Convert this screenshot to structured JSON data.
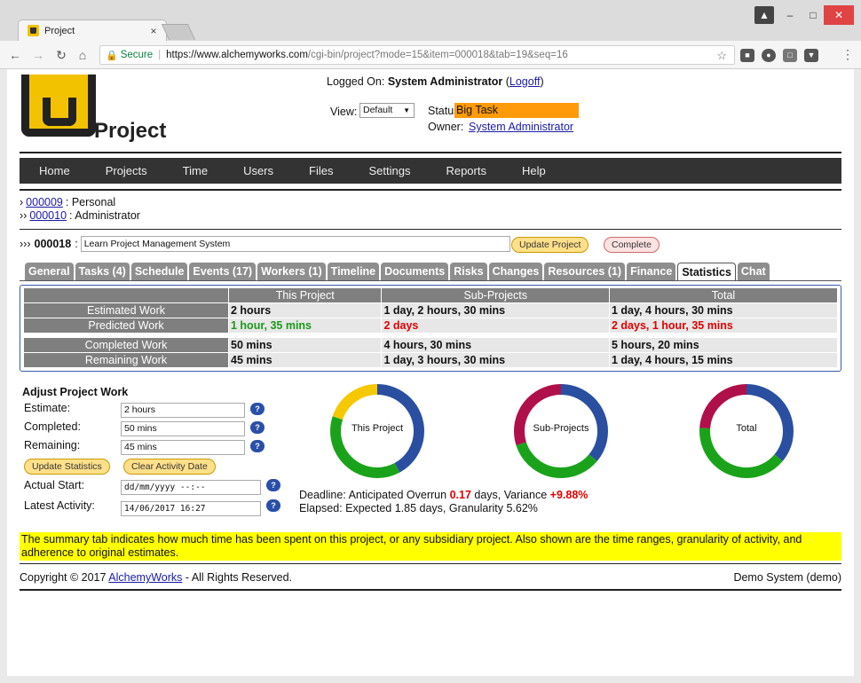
{
  "browser": {
    "tab_title": "Project",
    "tab_close": "×",
    "secure_label": "Secure",
    "url_host": "https://www.alchemyworks.com",
    "url_path": "/cgi-bin/project?mode=15&item=000018&tab=19&seq=16"
  },
  "header": {
    "app_title": "Project",
    "logged_on_label": "Logged On:",
    "user_name": "System Administrator",
    "logoff_label": "Logoff",
    "view_label": "View:",
    "view_selected": "Default",
    "status_label": "Status:",
    "status_value": "Big Task",
    "status_color": "#ff9a0a",
    "owner_label": "Owner:",
    "owner_value": "System Administrator"
  },
  "nav": {
    "items": [
      "Home",
      "Projects",
      "Time",
      "Users",
      "Files",
      "Settings",
      "Reports",
      "Help"
    ]
  },
  "breadcrumbs": [
    {
      "prefix": "›",
      "id": "000009",
      "name": ": Personal"
    },
    {
      "prefix": "››",
      "id": "000010",
      "name": ": Administrator"
    }
  ],
  "project": {
    "prefix": "›››",
    "id": "000018",
    "colon": ":",
    "name": "Learn Project Management System",
    "update_label": "Update Project",
    "complete_label": "Complete"
  },
  "tabs": [
    "General",
    "Tasks (4)",
    "Schedule",
    "Events (17)",
    "Workers (1)",
    "Timeline",
    "Documents",
    "Risks",
    "Changes",
    "Resources (1)",
    "Finance",
    "Statistics",
    "Chat"
  ],
  "active_tab": "Statistics",
  "stats": {
    "columns": [
      "This Project",
      "Sub-Projects",
      "Total"
    ],
    "rows": [
      {
        "label": "Estimated Work",
        "values": [
          "2 hours",
          "1 day, 2 hours, 30 mins",
          "1 day, 4 hours, 30 mins"
        ]
      },
      {
        "label": "Predicted Work",
        "values": [
          "1 hour, 35 mins",
          "2 days",
          "2 days, 1 hour, 35 mins"
        ]
      },
      {
        "label": "Completed Work",
        "values": [
          "50 mins",
          "4 hours, 30 mins",
          "5 hours, 20 mins"
        ]
      },
      {
        "label": "Remaining Work",
        "values": [
          "45 mins",
          "1 day, 3 hours, 30 mins",
          "1 day, 4 hours, 15 mins"
        ]
      }
    ]
  },
  "adjust": {
    "title": "Adjust Project Work",
    "estimate_label": "Estimate:",
    "estimate_value": "2 hours",
    "completed_label": "Completed:",
    "completed_value": "50 mins",
    "remaining_label": "Remaining:",
    "remaining_value": "45 mins",
    "update_stats_label": "Update Statistics",
    "clear_activity_label": "Clear Activity Date",
    "actual_start_label": "Actual Start:",
    "actual_start_value": "dd/mm/yyyy --:--",
    "latest_activity_label": "Latest Activity:",
    "latest_activity_value": "14/06/2017 16:27",
    "help_glyph": "?"
  },
  "donuts": [
    {
      "label": "This Project",
      "segments": [
        {
          "color": "#2a4fa0",
          "fraction": 0.42
        },
        {
          "color": "#1aa31a",
          "fraction": 0.38
        },
        {
          "color": "#f5c800",
          "fraction": 0.2
        }
      ]
    },
    {
      "label": "Sub-Projects",
      "segments": [
        {
          "color": "#2a4fa0",
          "fraction": 0.36
        },
        {
          "color": "#1aa31a",
          "fraction": 0.34
        },
        {
          "color": "#b0104a",
          "fraction": 0.3
        }
      ]
    },
    {
      "label": "Total",
      "segments": [
        {
          "color": "#2a4fa0",
          "fraction": 0.36
        },
        {
          "color": "#1aa31a",
          "fraction": 0.4
        },
        {
          "color": "#b0104a",
          "fraction": 0.24
        }
      ]
    }
  ],
  "deadline": {
    "line1_prefix": "Deadline: Anticipated Overrun",
    "overrun_value": "0.17",
    "line1_mid": "days, Variance",
    "variance_value": "+9.88%",
    "line2": "Elapsed: Expected 1.85 days, Granularity 5.62%"
  },
  "help_text": "The summary tab indicates how much time has been spent on this project, or any subsidiary project. Also shown are the time ranges, granularity of activity, and adherence to original estimates.",
  "footer": {
    "copyright_prefix": "Copyright © 2017",
    "company": "AlchemyWorks",
    "copyright_suffix": "- All Rights Reserved.",
    "system": "Demo System (demo)"
  }
}
